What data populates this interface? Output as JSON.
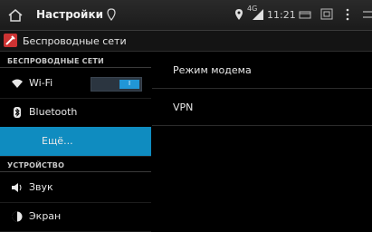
{
  "actionbar": {
    "title": "Настройки"
  },
  "status": {
    "network": "4G",
    "time": "11:21"
  },
  "subheader": {
    "title": "Беспроводные сети"
  },
  "left": {
    "cat_wireless": "БЕСПРОВОДНЫЕ СЕТИ",
    "wifi": "Wi-Fi",
    "wifi_toggle": "I",
    "bluetooth": "Bluetooth",
    "more": "Ещё...",
    "cat_device": "УСТРОЙСТВО",
    "sound": "Звук",
    "screen": "Экран"
  },
  "right": {
    "items": [
      "Режим модема",
      "VPN"
    ]
  },
  "colors": {
    "accent": "#0f8cc0",
    "toggle_on": "#2196d6"
  }
}
